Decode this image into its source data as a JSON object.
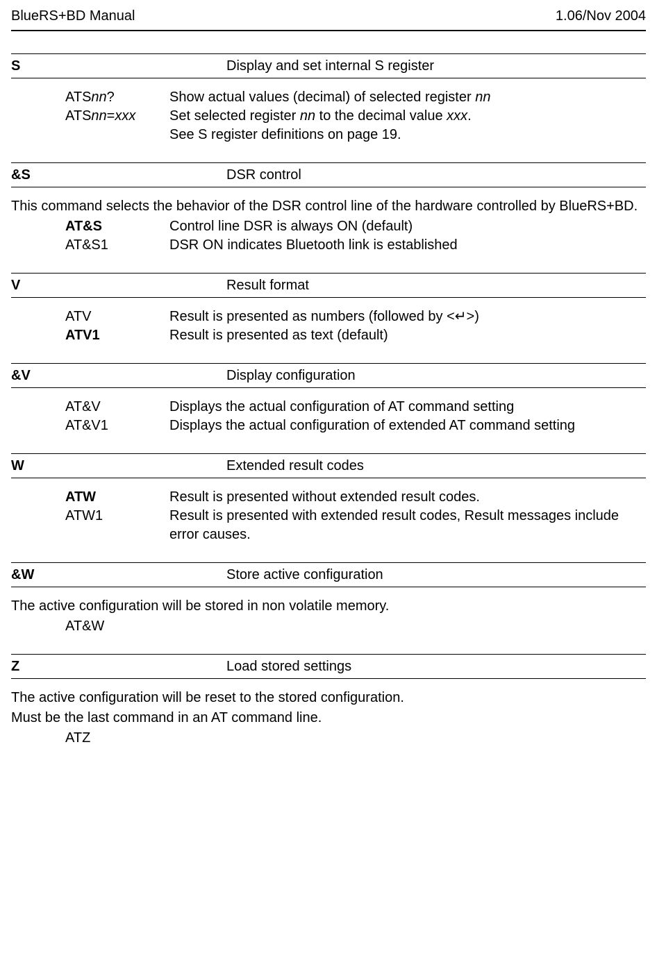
{
  "header": {
    "left": "BlueRS+BD Manual",
    "right": "1.06/Nov 2004"
  },
  "sections": [
    {
      "letter": "S",
      "title": "Display and set internal S register",
      "intro": null,
      "rows": [
        {
          "cmd_pre": "ATS",
          "cmd_ital": "nn",
          "cmd_post": "?",
          "bold": false,
          "desc_pre": "Show actual values (decimal) of selected register ",
          "desc_ital": "nn",
          "desc_post": ""
        },
        {
          "cmd_pre": "ATS",
          "cmd_ital": "nn",
          "cmd_mid": "=",
          "cmd_ital2": "xxx",
          "cmd_post": "",
          "bold": false,
          "desc_pre": "Set selected register ",
          "desc_ital": "nn",
          "desc_mid": " to the decimal value ",
          "desc_ital2": "xxx",
          "desc_post": "."
        }
      ],
      "trailing": "See S register definitions on page 19."
    },
    {
      "letter": "&S",
      "title": "DSR control",
      "intro": "This command selects the behavior of the DSR control line of the hardware controlled by BlueRS+BD.",
      "rows": [
        {
          "cmd": "AT&S",
          "bold": true,
          "desc": "Control line DSR is always ON (default)"
        },
        {
          "cmd": "AT&S1",
          "bold": false,
          "desc": "DSR ON indicates Bluetooth link is established"
        }
      ]
    },
    {
      "letter": "V",
      "title": "Result format",
      "intro": null,
      "rows": [
        {
          "cmd": "ATV",
          "bold": false,
          "desc": "Result is presented as numbers (followed by <↵>)"
        },
        {
          "cmd": "ATV1",
          "bold": true,
          "desc": "Result is presented as text (default)"
        }
      ]
    },
    {
      "letter": "&V",
      "title": "Display configuration",
      "intro": null,
      "rows": [
        {
          "cmd": "AT&V",
          "bold": false,
          "desc": "Displays the actual configuration of AT command setting"
        },
        {
          "cmd": "AT&V1",
          "bold": false,
          "desc": "Displays the actual configuration of extended AT command setting"
        }
      ]
    },
    {
      "letter": "W",
      "title": "Extended result codes",
      "intro": null,
      "rows": [
        {
          "cmd": "ATW",
          "bold": true,
          "desc": "Result is presented without extended result codes."
        },
        {
          "cmd": "ATW1",
          "bold": false,
          "desc": "Result is presented with extended result codes, Result messages include error causes."
        }
      ]
    },
    {
      "letter": "&W",
      "title": "Store active configuration",
      "intro": "The active configuration will be stored in non volatile memory.",
      "rows": [
        {
          "cmd": "AT&W",
          "bold": false,
          "desc": ""
        }
      ]
    },
    {
      "letter": "Z",
      "title": "Load stored settings",
      "intro": "The active configuration will be reset to the stored configuration.",
      "extra": "Must be the last command in an AT command line.",
      "rows": [
        {
          "cmd": "ATZ",
          "bold": false,
          "desc": ""
        }
      ]
    }
  ]
}
